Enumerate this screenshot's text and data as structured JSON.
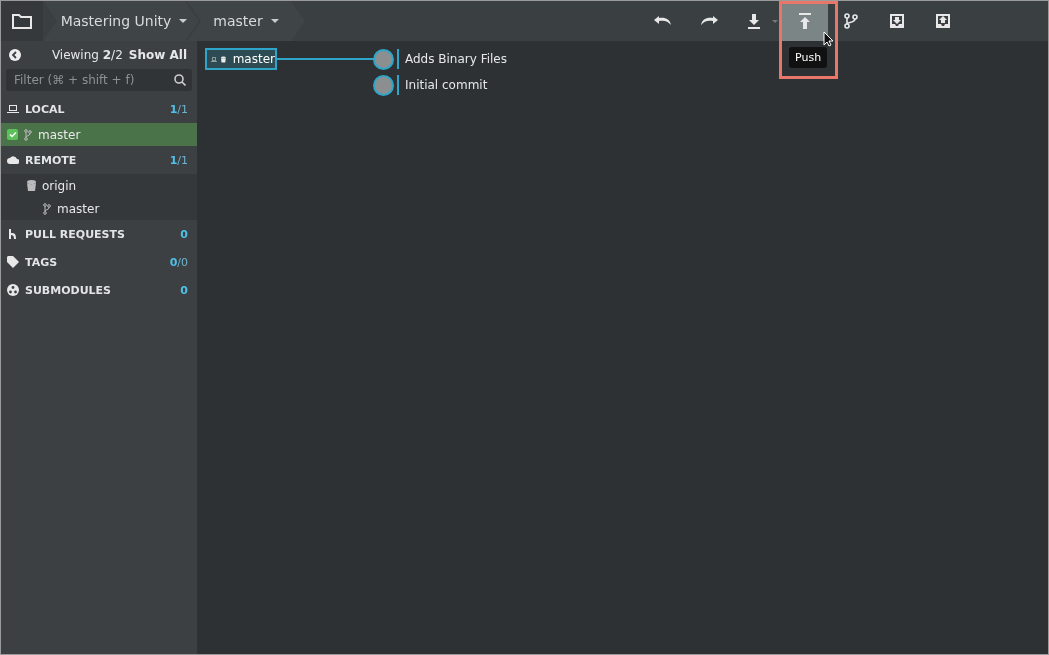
{
  "repo": {
    "name": "Mastering Unity"
  },
  "branch": {
    "name": "master"
  },
  "toolbar": [
    {
      "kind": "undo",
      "hovered": false
    },
    {
      "kind": "redo",
      "hovered": false
    },
    {
      "kind": "pull",
      "hovered": false
    },
    {
      "kind": "push",
      "hovered": true,
      "tooltip": "Push"
    },
    {
      "kind": "branch",
      "hovered": false
    },
    {
      "kind": "stash",
      "hovered": false
    },
    {
      "kind": "pop",
      "hovered": false
    }
  ],
  "sidebar": {
    "viewing": "Viewing **2**/2",
    "show_all": "Show All",
    "filter": {
      "placeholder": "Filter (⌘ + shift + f)"
    },
    "sections": [
      {
        "kind": "local",
        "label": "LOCAL",
        "count": "**1**/1",
        "items": [
          {
            "label": "master",
            "checked": true,
            "selected": true
          }
        ]
      },
      {
        "kind": "remote",
        "label": "REMOTE",
        "count": "**1**/1",
        "items": [
          {
            "label": "origin",
            "children": [
              {
                "label": "master"
              }
            ]
          }
        ]
      },
      {
        "kind": "pulls",
        "label": "PULL REQUESTS",
        "count": "**0**"
      },
      {
        "kind": "tags",
        "label": "TAGS",
        "count": "**0**/0"
      },
      {
        "kind": "submodules",
        "label": "SUBMODULES",
        "count": "**0**"
      }
    ]
  },
  "graph": {
    "branch_label": "master",
    "commits": [
      {
        "message": "Adds Binary Files"
      },
      {
        "message": "Initial commit"
      }
    ]
  }
}
